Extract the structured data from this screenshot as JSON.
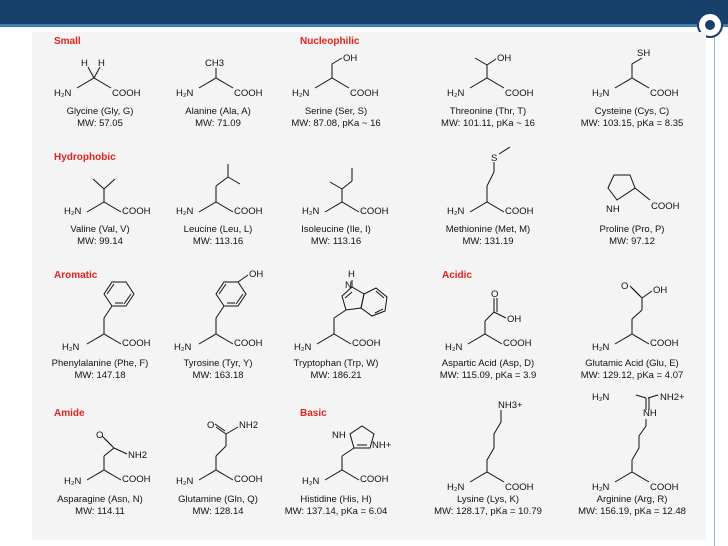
{
  "categories": {
    "small": "Small",
    "nucleophilic": "Nucleophilic",
    "hydrophobic": "Hydrophobic",
    "aromatic": "Aromatic",
    "acidic": "Acidic",
    "amide": "Amide",
    "basic": "Basic"
  },
  "atoms": {
    "h2n": "H₂N",
    "cooh": "COOH",
    "h": "H",
    "ch3": "CH3",
    "oh": "OH",
    "sh": "SH",
    "s": "S",
    "nh": "NH",
    "n": "N",
    "o": "O",
    "nh2": "NH2",
    "nh_plus": "NH+",
    "nh3_plus": "NH3+",
    "nh2_plus": "NH2+"
  },
  "amino_acids": [
    {
      "name": "Glycine (Gly, G)",
      "mw": "MW: 57.05"
    },
    {
      "name": "Alanine (Ala, A)",
      "mw": "MW: 71.09"
    },
    {
      "name": "Serine (Ser, S)",
      "mw": "MW: 87.08, pKa ~ 16"
    },
    {
      "name": "Threonine (Thr, T)",
      "mw": "MW: 101.11, pKa ~ 16"
    },
    {
      "name": "Cysteine (Cys, C)",
      "mw": "MW: 103.15, pKa = 8.35"
    },
    {
      "name": "Valine (Val, V)",
      "mw": "MW: 99.14"
    },
    {
      "name": "Leucine (Leu, L)",
      "mw": "MW: 113.16"
    },
    {
      "name": "Isoleucine (Ile, I)",
      "mw": "MW: 113.16"
    },
    {
      "name": "Methionine (Met, M)",
      "mw": "MW: 131.19"
    },
    {
      "name": "Proline (Pro, P)",
      "mw": "MW: 97.12"
    },
    {
      "name": "Phenylalanine (Phe, F)",
      "mw": "MW: 147.18"
    },
    {
      "name": "Tyrosine (Tyr, Y)",
      "mw": "MW: 163.18"
    },
    {
      "name": "Tryptophan (Trp, W)",
      "mw": "MW: 186.21"
    },
    {
      "name": "Aspartic Acid (Asp, D)",
      "mw": "MW: 115.09, pKa = 3.9"
    },
    {
      "name": "Glutamic Acid (Glu, E)",
      "mw": "MW: 129.12, pKa = 4.07"
    },
    {
      "name": "Asparagine (Asn, N)",
      "mw": "MW: 114.11"
    },
    {
      "name": "Glutamine (Gln, Q)",
      "mw": "MW: 128.14"
    },
    {
      "name": "Histidine (His, H)",
      "mw": "MW: 137.14, pKa = 6.04"
    },
    {
      "name": "Lysine (Lys, K)",
      "mw": "MW: 128.17, pKa = 10.79"
    },
    {
      "name": "Arginine (Arg, R)",
      "mw": "MW: 156.19, pKa = 12.48"
    }
  ],
  "colors": {
    "header_bar": "#17406d",
    "header_accent": "#3f7fb0",
    "category_label": "#e8221b",
    "slide_background": "#f4f4f4"
  }
}
